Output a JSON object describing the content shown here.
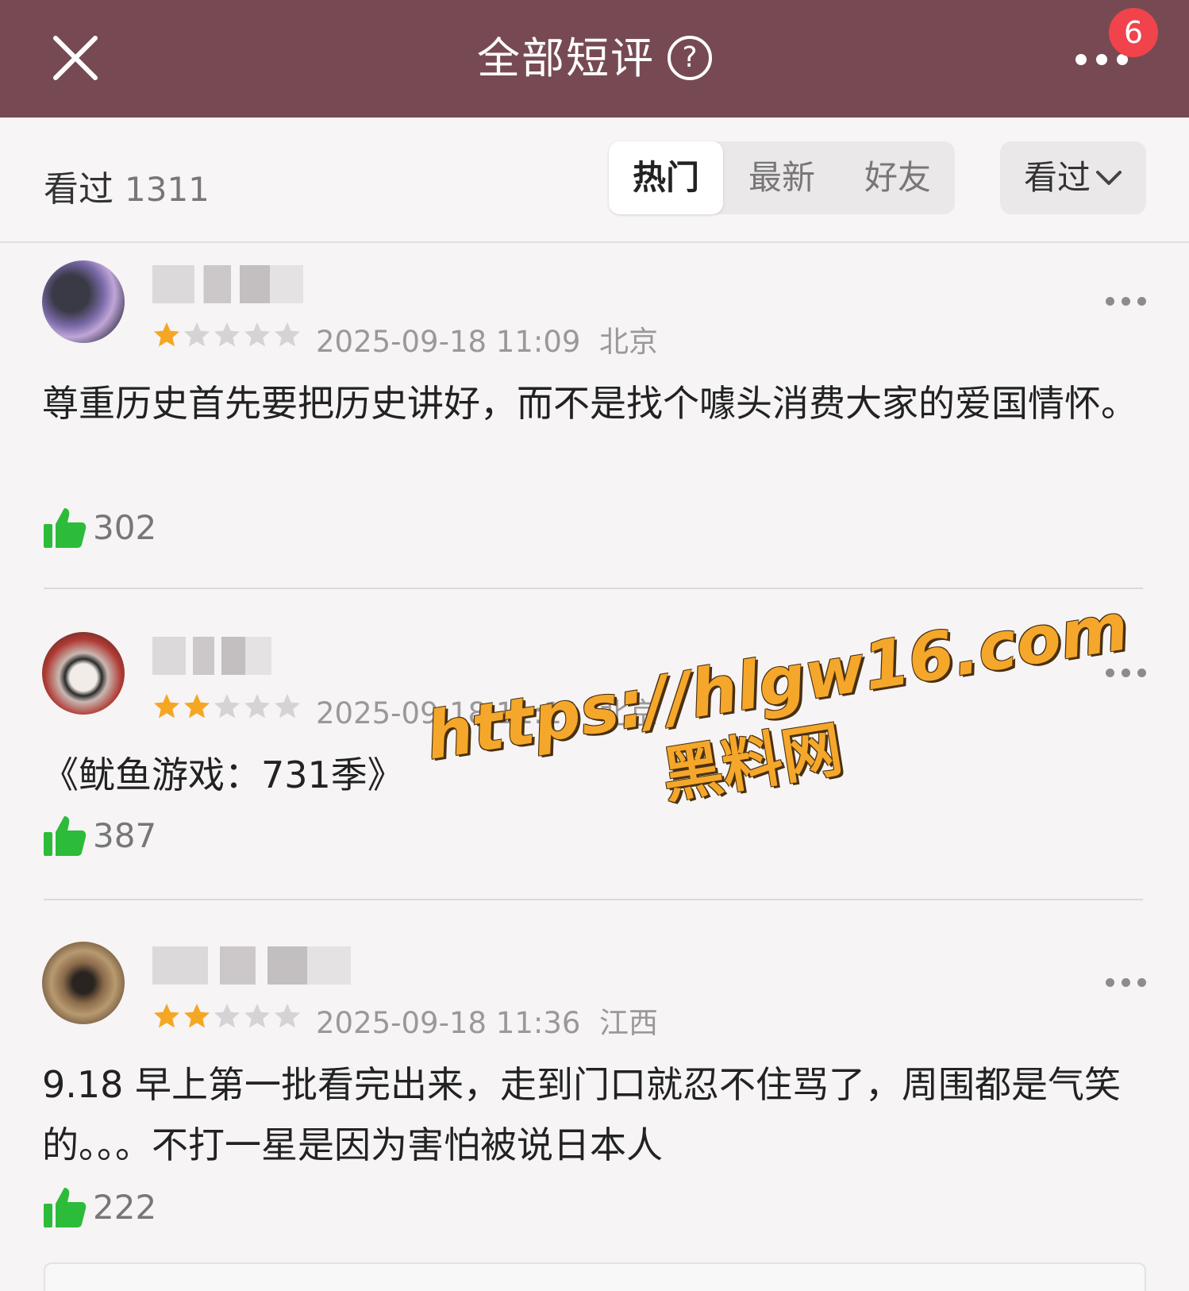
{
  "header": {
    "title": "全部短评",
    "help_glyph": "?",
    "notification_count": "6"
  },
  "filter": {
    "watched_label": "看过",
    "watched_count": "1311",
    "tabs": [
      "热门",
      "最新",
      "好友"
    ],
    "active_tab": "热门",
    "dropdown_label": "看过"
  },
  "reviews": [
    {
      "rating": 1,
      "time": "2025-09-18 11:09",
      "location": "北京",
      "content": "尊重历史首先要把历史讲好，而不是找个噱头消费大家的爱国情怀。",
      "likes": "302"
    },
    {
      "rating": 2,
      "time": "2025-09-18 11:11",
      "location": "北京",
      "content": "《鱿鱼游戏：731季》",
      "likes": "387"
    },
    {
      "rating": 2,
      "time": "2025-09-18 11:36",
      "location": "江西",
      "content": "9.18 早上第一批看完出来，走到门口就忍不住骂了，周围都是气笑的。。。不打一星是因为害怕被说日本人",
      "likes": "222"
    }
  ],
  "watermark": {
    "url": "https://hlgw16.com",
    "site": "黑料网"
  },
  "colors": {
    "header_bg": "#774a53",
    "star_on": "#f5a623",
    "star_off": "#d6d3d4",
    "like_green": "#2dbb3a",
    "badge_red": "#f0434b"
  }
}
